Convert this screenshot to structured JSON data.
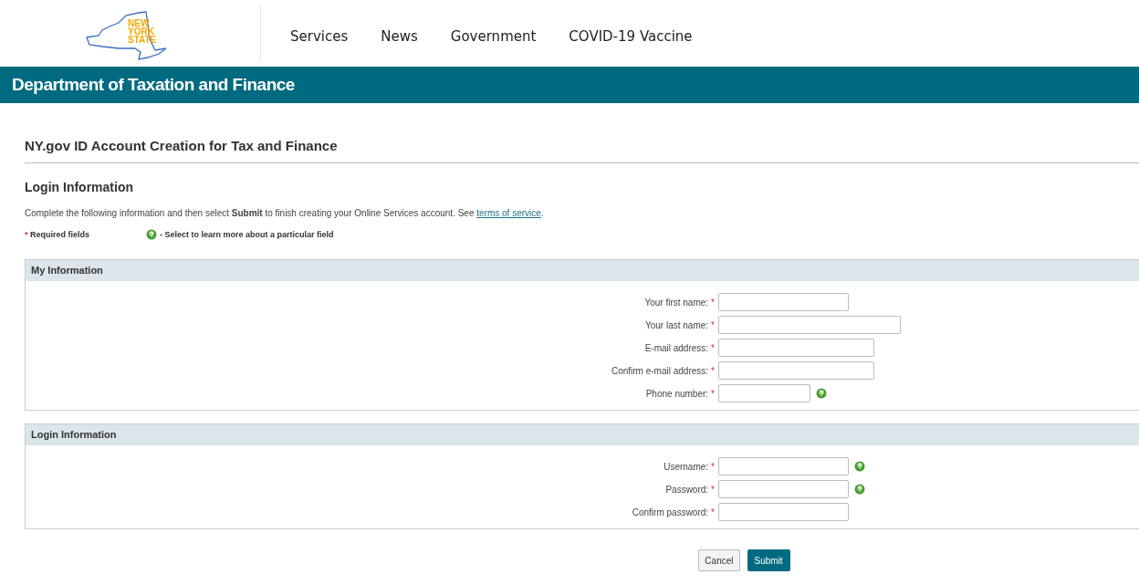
{
  "logo": {
    "lines": [
      "NEW",
      "YORK",
      "STATE"
    ]
  },
  "nav": [
    "Services",
    "News",
    "Government",
    "COVID-19 Vaccine"
  ],
  "banner": "Department of Taxation and Finance",
  "page_title": "NY.gov ID Account Creation for Tax and Finance",
  "section_title": "Login Information",
  "intro": "Complete the following information and then select **Submit** to finish creating your Online Services account. See",
  "intro_link": "terms of service",
  "intro_end": ".",
  "legend": {
    "required_mark": "*",
    "required": "Required fields",
    "help": "- Select to learn more about a particular field"
  },
  "panels": [
    {
      "title": "My Information",
      "fields": [
        {
          "label": "Your first name:",
          "mark": "*",
          "help": false
        },
        {
          "label": "Your last name:",
          "mark": "*",
          "help": false
        },
        {
          "label": "E-mail address:",
          "mark": "*",
          "help": false
        },
        {
          "label": "Confirm e-mail address:",
          "mark": "*",
          "help": false
        },
        {
          "label": "Phone number:",
          "mark": "*",
          "help": true
        }
      ]
    },
    {
      "title": "Login Information",
      "fields": [
        {
          "label": "Username:",
          "mark": "*",
          "help": true
        },
        {
          "label": "Password:",
          "mark": "*",
          "help": true
        },
        {
          "label": "Confirm password:",
          "mark": "*",
          "help": false
        }
      ]
    }
  ],
  "buttons": [
    {
      "label": "Cancel",
      "kind": "secondary"
    },
    {
      "label": "Submit",
      "kind": "primary"
    }
  ]
}
